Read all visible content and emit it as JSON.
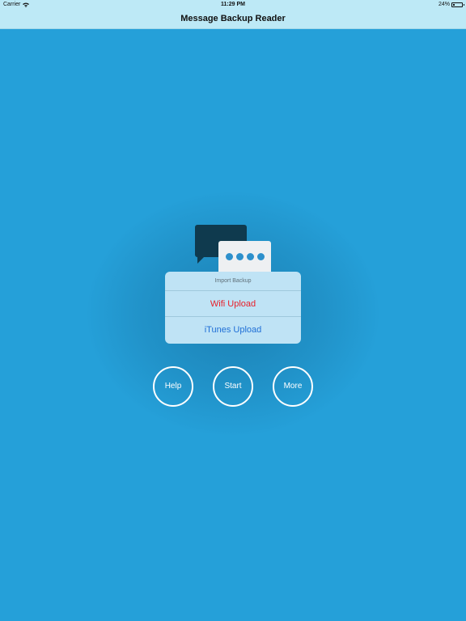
{
  "status_bar": {
    "carrier": "Carrier",
    "time": "11:29 PM",
    "battery": "24%",
    "battery_level": 0.24
  },
  "nav": {
    "title": "Message Backup Reader"
  },
  "logo": {
    "icon": "chat-bubbles-icon",
    "dark_color": "#0f3a4e",
    "light_color": "#eef0f2",
    "dot_color": "#2d90cc"
  },
  "import_menu": {
    "header": "Import Backup",
    "items": [
      {
        "label": "Wifi Upload",
        "color": "#e8202a"
      },
      {
        "label": "iTunes Upload",
        "color": "#1f6fd6"
      }
    ]
  },
  "actions": [
    {
      "label": "Help"
    },
    {
      "label": "Start"
    },
    {
      "label": "More"
    }
  ],
  "colors": {
    "background": "#25a0d9",
    "bar": "#bde9f6"
  }
}
